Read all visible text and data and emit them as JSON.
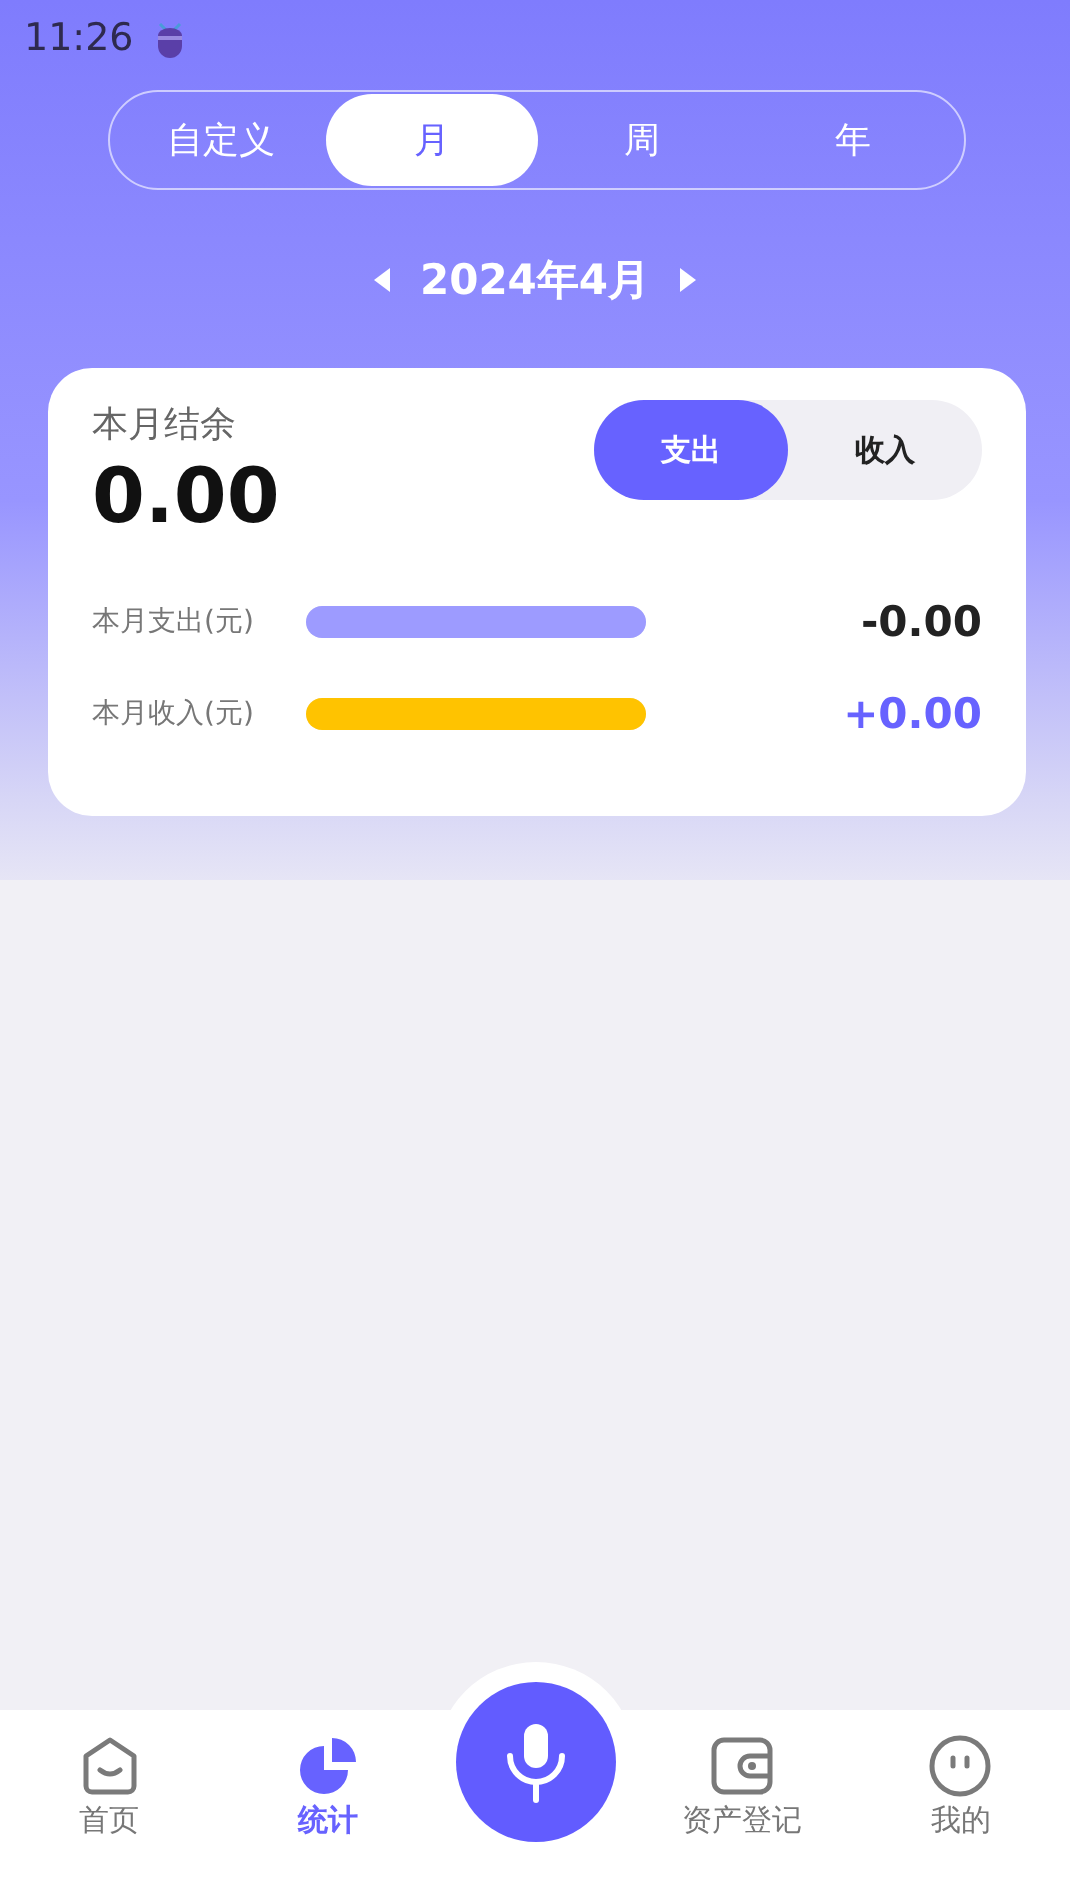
{
  "status_bar": {
    "time": "11:26"
  },
  "period_tabs": [
    {
      "label": "自定义",
      "selected": false
    },
    {
      "label": "月",
      "selected": true
    },
    {
      "label": "周",
      "selected": false
    },
    {
      "label": "年",
      "selected": false
    }
  ],
  "period": {
    "label": "2024年4月"
  },
  "summary": {
    "title": "本月结余",
    "amount": "0.00",
    "toggle": [
      {
        "label": "支出",
        "selected": true
      },
      {
        "label": "收入",
        "selected": false
      }
    ],
    "rows": [
      {
        "label": "本月支出(元)",
        "level": 1,
        "color": "#9d9bff",
        "value": "-0.00",
        "kind": "expense"
      },
      {
        "label": "本月收入(元)",
        "level": 1,
        "color": "#ffc300",
        "value": "+0.00",
        "kind": "income"
      }
    ]
  },
  "nav": [
    {
      "label": "首页",
      "kind": "tab",
      "selected": false
    },
    {
      "label": "统计",
      "kind": "tab",
      "selected": true
    },
    {
      "kind": "center"
    },
    {
      "label": "资产登记",
      "kind": "tab",
      "selected": false
    },
    {
      "label": "我的",
      "kind": "tab",
      "selected": false
    }
  ]
}
